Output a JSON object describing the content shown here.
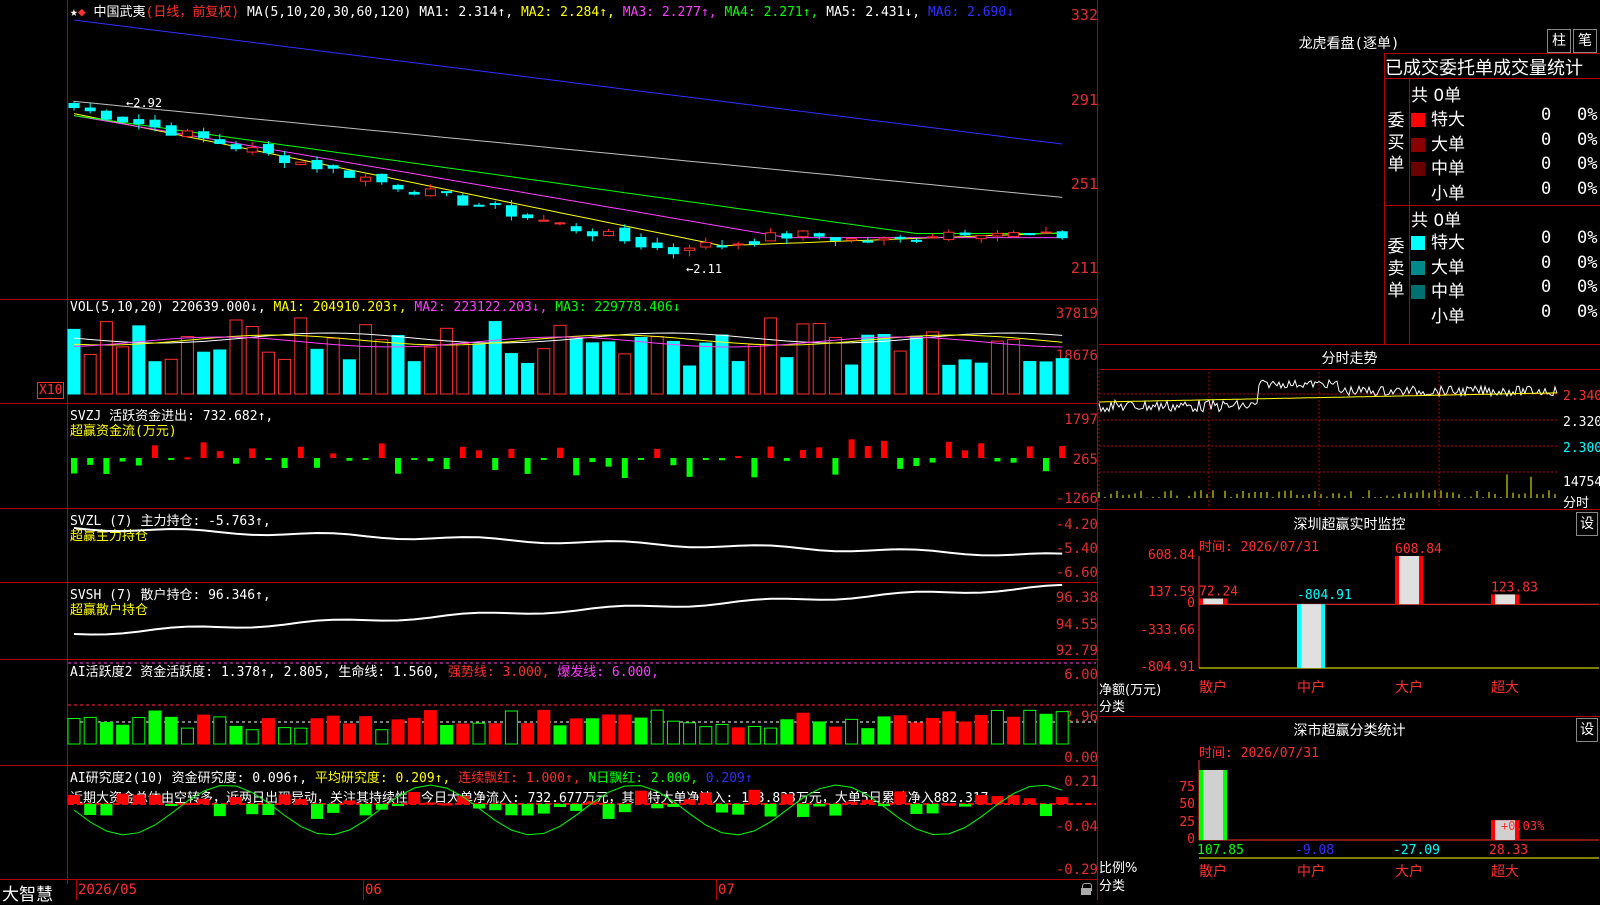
{
  "header": {
    "star": "★",
    "diamond": "◆",
    "stock_name": "中国武夷",
    "period": "(日线，前复权)",
    "ma_label": "MA(5,10,20,30,60,120)",
    "ma1": "MA1: 2.314↑,",
    "ma2": "MA2: 2.284↑,",
    "ma3": "MA3: 2.277↑,",
    "ma4": "MA4: 2.271↑,",
    "ma5": "MA5: 2.431↓,",
    "ma6": "MA6: 2.690↓"
  },
  "price_axis": [
    "332",
    "291",
    "251",
    "211"
  ],
  "price_annotations": {
    "high": "←2.92",
    "low": "←2.11"
  },
  "vol": {
    "title": "VOL(5,10,20)",
    "value": "220639.000↓,",
    "ma1": "MA1: 204910.203↑,",
    "ma2": "MA2: 223122.203↓,",
    "ma3": "MA3: 229778.406↓",
    "axis": [
      "37819",
      "18676"
    ],
    "unit": "X10"
  },
  "svzj": {
    "title": "SVZJ  活跃资金进出: 732.682↑,",
    "subtitle": "超赢资金流(万元)",
    "axis": [
      "1797",
      "265",
      "-1266"
    ]
  },
  "svzl": {
    "title": "SVZL (7) 主力持仓: -5.763↑,",
    "subtitle": "超赢主力持仓",
    "axis": [
      "-4.20",
      "-5.40",
      "-6.60"
    ]
  },
  "svsh": {
    "title": "SVSH (7) 散户持仓: 96.346↑,",
    "subtitle": "超赢散户持仓",
    "axis": [
      "96.38",
      "94.55",
      "92.79"
    ]
  },
  "ai1": {
    "title_a": "AI活跃度2 资金活跃度: 1.378↑, 2.805, 生命线: 1.560,",
    "title_b": "强势线: 3.000,",
    "title_c": "爆发线: 6.000,",
    "axis": [
      "6.00",
      "2.96",
      "0.00"
    ]
  },
  "ai2": {
    "title_a": "AI研究度2(10) 资金研究度: 0.096↑,",
    "title_b": "平均研究度: 0.209↑,",
    "title_c": "连续飘红: 1.000↑,",
    "title_d": "N日飘红: 2.000,",
    "title_e": "0.209↑",
    "comment": "近期大资金总体由空转多，近两日出现异动，关注其持续性，今日大单净流入: 732.677万元，其中特大单净流入: 123.833万元，大单5日累计净入882.317",
    "axis": [
      "0.21",
      "-0.04",
      "-0.29"
    ]
  },
  "footer": {
    "brand": "大智慧",
    "dates": [
      "2026/05",
      "06",
      "07"
    ]
  },
  "lhb": {
    "title": "龙虎看盘(逐单)",
    "btn1": "柱",
    "btn2": "笔",
    "heading": "已成交委托单成交量统计",
    "buy_label": "委买单",
    "sell_label": "委卖单",
    "buy_total": "共 0单",
    "sell_total": "共 0单",
    "buy_rows": [
      {
        "name": "特大",
        "count": "0",
        "pct": "0%",
        "color": "#ff0000"
      },
      {
        "name": "大单",
        "count": "0",
        "pct": "0%",
        "color": "#8b0000"
      },
      {
        "name": "中单",
        "count": "0",
        "pct": "0%",
        "color": "#6b0000"
      },
      {
        "name": "小单",
        "count": "0",
        "pct": "0%",
        "color": "#000000"
      }
    ],
    "sell_rows": [
      {
        "name": "特大",
        "count": "0",
        "pct": "0%",
        "color": "#00ffff"
      },
      {
        "name": "大单",
        "count": "0",
        "pct": "0%",
        "color": "#008b8b"
      },
      {
        "name": "中单",
        "count": "0",
        "pct": "0%",
        "color": "#007070"
      },
      {
        "name": "小单",
        "count": "0",
        "pct": "0%",
        "color": "#000000"
      }
    ]
  },
  "intraday": {
    "title": "分时走势",
    "axis": [
      "2.340",
      "2.320",
      "2.300"
    ],
    "vol_label": "14754",
    "vol_unit": "分时"
  },
  "monitor": {
    "title": "深圳超赢实时监控",
    "btn": "设",
    "time": "时间: 2026/07/31",
    "axis": [
      "608.84",
      "137.59",
      "0",
      "-333.66",
      "-804.91"
    ],
    "y_title": "净额(万元)",
    "x_title": "分类",
    "categories": [
      "散户",
      "中户",
      "大户",
      "超大"
    ],
    "values": [
      72.24,
      -804.91,
      608.84,
      123.83
    ],
    "value_labels": [
      "72.24",
      "-804.91",
      "608.84",
      "123.83"
    ]
  },
  "classify": {
    "title": "深市超赢分类统计",
    "btn": "设",
    "time": "时间: 2026/07/31",
    "axis": [
      "75",
      "50",
      "25",
      "0"
    ],
    "y_title": "比例%",
    "x_title": "分类",
    "categories": [
      "散户",
      "中户",
      "大户",
      "超大"
    ],
    "values": [
      107.85,
      -9.08,
      -27.09,
      28.33
    ],
    "value_labels": [
      "107.85",
      "-9.08",
      "-27.09",
      "28.33"
    ],
    "note": "+0.03%"
  },
  "chart_data": [
    {
      "type": "candlestick",
      "title": "中国武夷(日线，前复权)",
      "ylim": [
        2.11,
        3.32
      ],
      "annotations": {
        "high": 2.92,
        "low": 2.11
      },
      "ma_values": {
        "MA1": 2.314,
        "MA2": 2.284,
        "MA3": 2.277,
        "MA4": 2.271,
        "MA5": 2.431,
        "MA6": 2.69
      }
    },
    {
      "type": "bar",
      "title": "VOL(5,10,20)",
      "ylim": [
        0,
        37819
      ],
      "last": 220639.0,
      "ma": [
        204910.203,
        223122.203,
        229778.406
      ]
    }
  ]
}
